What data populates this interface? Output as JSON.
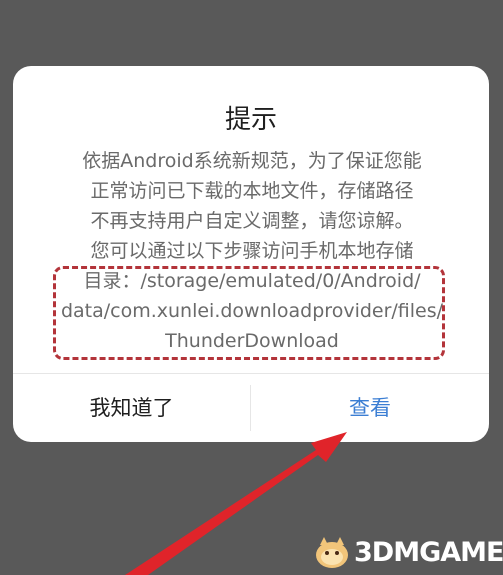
{
  "dialog": {
    "title": "提示",
    "message_lines": [
      "依据Android系统新规范，为了保证您能",
      "正常访问已下载的本地文件，存储路径",
      "不再支持用户自定义调整，请您谅解。",
      "您可以通过以下步骤访问手机本地存储"
    ],
    "path_lines": [
      "目录：/storage/emulated/0/Android/",
      "data/com.xunlei.downloadprovider/files/",
      "ThunderDownload"
    ],
    "buttons": {
      "dismiss_label": "我知道了",
      "view_label": "查看"
    }
  },
  "annotation": {
    "highlight_color": "#b3343a",
    "arrow_color": "#e0242a"
  },
  "watermark": {
    "text": "3DMGAME"
  },
  "colors": {
    "backdrop": "#595959",
    "dialog_bg": "#ffffff",
    "accent": "#3b7ed3"
  }
}
